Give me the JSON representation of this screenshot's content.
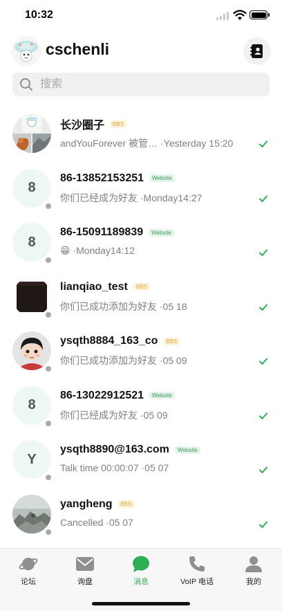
{
  "status_bar": {
    "time": "10:32"
  },
  "header": {
    "username": "cschenli",
    "contacts_icon": "contact-book-icon"
  },
  "search": {
    "placeholder": "搜索",
    "icon": "search-icon"
  },
  "conversations": [
    {
      "name": "长沙圈子",
      "badge": "BBS",
      "preview": "andYouForever 被管… ·Yesterday 15:20",
      "avatar": "group-collage",
      "status": "delivered"
    },
    {
      "name": "86-13852153251",
      "badge": "Website",
      "preview": "你们已经成为好友 ·Monday14:27",
      "avatar": "8",
      "status": "delivered"
    },
    {
      "name": "86-15091189839",
      "badge": "Website",
      "preview": "😁 ·Monday14:12",
      "avatar": "8",
      "status": "delivered"
    },
    {
      "name": "lianqiao_test",
      "badge": "BBS",
      "preview": "你们已成功添加为好友 ·05 18",
      "avatar": "dark-photo",
      "status": "delivered"
    },
    {
      "name": "ysqth8884_163_co",
      "badge": "BBS",
      "preview": "你们已成功添加为好友 ·05 09",
      "avatar": "cartoon-girl",
      "status": "delivered"
    },
    {
      "name": "86-13022912521",
      "badge": "Website",
      "preview": "你们已经成为好友 ·05 09",
      "avatar": "8",
      "status": "delivered"
    },
    {
      "name": "ysqth8890@163.com",
      "badge": "Website",
      "preview": "Talk time 00:00:07 ·05 07",
      "avatar": "Y",
      "status": "delivered"
    },
    {
      "name": "yangheng",
      "badge": "BBS",
      "preview": "Cancelled ·05 07",
      "avatar": "rock-photo",
      "status": "delivered"
    }
  ],
  "tabs": [
    {
      "label": "论坛",
      "icon": "planet-icon",
      "active": false
    },
    {
      "label": "询盘",
      "icon": "mail-icon",
      "active": false
    },
    {
      "label": "消息",
      "icon": "chat-bubble-icon",
      "active": true
    },
    {
      "label": "VoIP 电话",
      "icon": "phone-icon",
      "active": false
    },
    {
      "label": "我的",
      "icon": "person-icon",
      "active": false
    }
  ],
  "colors": {
    "accent": "#2eae55",
    "bbs_badge": "#e2a63a",
    "website_badge": "#3a9d5d",
    "muted_text": "#808080"
  }
}
